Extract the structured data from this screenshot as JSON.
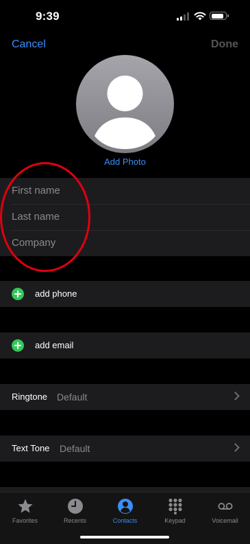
{
  "status_bar": {
    "time": "9:39"
  },
  "nav": {
    "cancel_label": "Cancel",
    "done_label": "Done"
  },
  "photo": {
    "add_label": "Add Photo"
  },
  "name_fields": {
    "first_placeholder": "First name",
    "last_placeholder": "Last name",
    "company_placeholder": "Company"
  },
  "add_rows": {
    "phone_label": "add phone",
    "email_label": "add email"
  },
  "settings": {
    "ringtone": {
      "label": "Ringtone",
      "value": "Default"
    },
    "text_tone": {
      "label": "Text Tone",
      "value": "Default"
    }
  },
  "tabs": [
    {
      "label": "Favorites",
      "icon": "star-icon",
      "active": false
    },
    {
      "label": "Recents",
      "icon": "clock-icon",
      "active": false
    },
    {
      "label": "Contacts",
      "icon": "person-circle-icon",
      "active": true
    },
    {
      "label": "Keypad",
      "icon": "keypad-icon",
      "active": false
    },
    {
      "label": "Voicemail",
      "icon": "voicemail-icon",
      "active": false
    }
  ],
  "colors": {
    "accent": "#3a8ef5",
    "add_green": "#34c759",
    "annotation_red": "#e00010"
  }
}
